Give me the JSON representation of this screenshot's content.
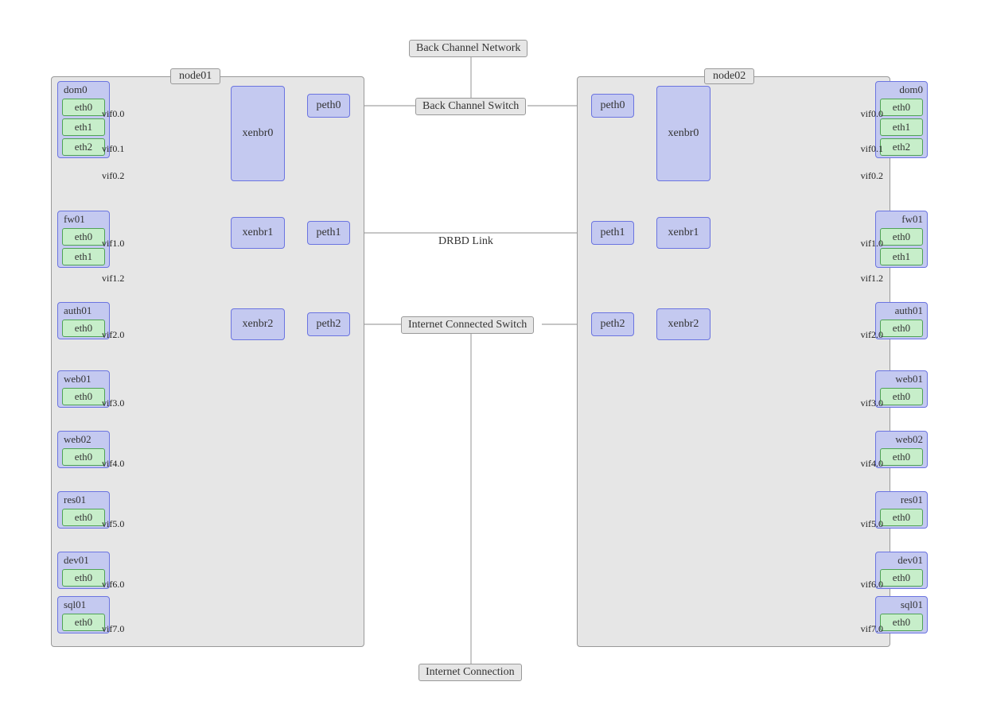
{
  "nodes": {
    "left": {
      "title": "node01",
      "domains": [
        {
          "name": "dom0",
          "nics": [
            "eth0",
            "eth1",
            "eth2"
          ],
          "vifs": [
            "vif0.0",
            "vif0.1",
            "vif0.2"
          ]
        },
        {
          "name": "fw01",
          "nics": [
            "eth0",
            "eth1"
          ],
          "vifs": [
            "vif1.0",
            "vif1.2"
          ]
        },
        {
          "name": "auth01",
          "nics": [
            "eth0"
          ],
          "vifs": [
            "vif2.0"
          ]
        },
        {
          "name": "web01",
          "nics": [
            "eth0"
          ],
          "vifs": [
            "vif3.0"
          ]
        },
        {
          "name": "web02",
          "nics": [
            "eth0"
          ],
          "vifs": [
            "vif4.0"
          ]
        },
        {
          "name": "res01",
          "nics": [
            "eth0"
          ],
          "vifs": [
            "vif5.0"
          ]
        },
        {
          "name": "dev01",
          "nics": [
            "eth0"
          ],
          "vifs": [
            "vif6.0"
          ]
        },
        {
          "name": "sql01",
          "nics": [
            "eth0"
          ],
          "vifs": [
            "vif7.0"
          ]
        }
      ],
      "bridges": [
        "xenbr0",
        "xenbr1",
        "xenbr2"
      ],
      "peth": [
        "peth0",
        "peth1",
        "peth2"
      ]
    },
    "right": {
      "title": "node02",
      "domains": [
        {
          "name": "dom0",
          "nics": [
            "eth0",
            "eth1",
            "eth2"
          ],
          "vifs": [
            "vif0.0",
            "vif0.1",
            "vif0.2"
          ]
        },
        {
          "name": "fw01",
          "nics": [
            "eth0",
            "eth1"
          ],
          "vifs": [
            "vif1.0",
            "vif1.2"
          ]
        },
        {
          "name": "auth01",
          "nics": [
            "eth0"
          ],
          "vifs": [
            "vif2.0"
          ]
        },
        {
          "name": "web01",
          "nics": [
            "eth0"
          ],
          "vifs": [
            "vif3.0"
          ]
        },
        {
          "name": "web02",
          "nics": [
            "eth0"
          ],
          "vifs": [
            "vif4.0"
          ]
        },
        {
          "name": "res01",
          "nics": [
            "eth0"
          ],
          "vifs": [
            "vif5.0"
          ]
        },
        {
          "name": "dev01",
          "nics": [
            "eth0"
          ],
          "vifs": [
            "vif6.0"
          ]
        },
        {
          "name": "sql01",
          "nics": [
            "eth0"
          ],
          "vifs": [
            "vif7.0"
          ]
        }
      ],
      "bridges": [
        "xenbr0",
        "xenbr1",
        "xenbr2"
      ],
      "peth": [
        "peth0",
        "peth1",
        "peth2"
      ]
    }
  },
  "center": {
    "top": "Back Channel Network",
    "switch_bc": "Back Channel Switch",
    "drbd": "DRBD Link",
    "switch_net": "Internet Connected Switch",
    "inet": "Internet Connection"
  },
  "chart_data": {
    "type": "diagram",
    "description": "Two Xen host nodes (node01, node02) each containing 8 domains with virtual NICs connecting via vif to three bridges (xenbr0-2) and physical eth (peth0-2). peth0 of both connects to Back Channel Switch under Back Channel Network. peth1 of both linked as DRBD Link. peth2 of both connects to Internet Connected Switch -> Internet Connection.",
    "connections": [
      {
        "node": "node01",
        "from": "dom0.eth0",
        "vif": "vif0.0",
        "to": "xenbr0"
      },
      {
        "node": "node01",
        "from": "dom0.eth1",
        "vif": "vif0.1",
        "to": "xenbr1"
      },
      {
        "node": "node01",
        "from": "dom0.eth2",
        "vif": "vif0.2",
        "to": "xenbr2"
      },
      {
        "node": "node01",
        "from": "fw01.eth0",
        "vif": "vif1.0",
        "to": "xenbr0"
      },
      {
        "node": "node01",
        "from": "fw01.eth1",
        "vif": "vif1.2",
        "to": "xenbr2"
      },
      {
        "node": "node01",
        "from": "auth01.eth0",
        "vif": "vif2.0",
        "to": "xenbr0"
      },
      {
        "node": "node01",
        "from": "web01.eth0",
        "vif": "vif3.0",
        "to": "xenbr0"
      },
      {
        "node": "node01",
        "from": "web02.eth0",
        "vif": "vif4.0",
        "to": "xenbr0"
      },
      {
        "node": "node01",
        "from": "res01.eth0",
        "vif": "vif5.0",
        "to": "xenbr0"
      },
      {
        "node": "node01",
        "from": "dev01.eth0",
        "vif": "vif6.0",
        "to": "xenbr0"
      },
      {
        "node": "node01",
        "from": "sql01.eth0",
        "vif": "vif7.0",
        "to": "xenbr0"
      },
      {
        "node": "node01",
        "from": "xenbr0",
        "to": "peth0"
      },
      {
        "node": "node01",
        "from": "xenbr1",
        "to": "peth1"
      },
      {
        "node": "node01",
        "from": "xenbr2",
        "to": "peth2"
      },
      {
        "from": "node01.peth0",
        "to": "BackChannelSwitch"
      },
      {
        "from": "node02.peth0",
        "to": "BackChannelSwitch"
      },
      {
        "from": "node01.peth1",
        "to": "node02.peth1",
        "label": "DRBDLink"
      },
      {
        "from": "node01.peth2",
        "to": "InternetSwitch"
      },
      {
        "from": "node02.peth2",
        "to": "InternetSwitch"
      },
      {
        "from": "BackChannelNetwork",
        "to": "BackChannelSwitch"
      },
      {
        "from": "InternetSwitch",
        "to": "InternetConnection"
      }
    ]
  }
}
